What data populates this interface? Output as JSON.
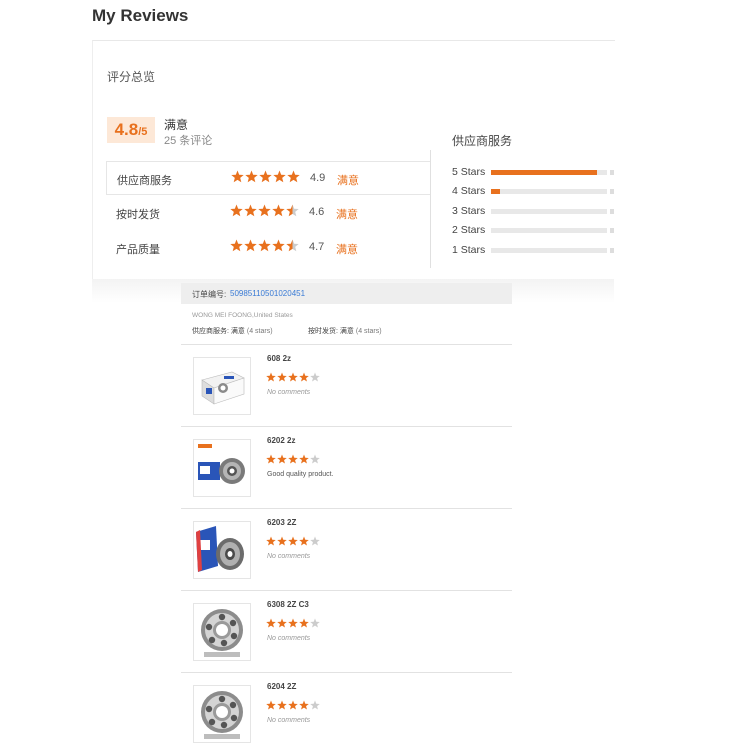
{
  "page": {
    "title": "My Reviews"
  },
  "summary": {
    "section_title": "评分总览",
    "score": "4.8",
    "score_max": "/5",
    "overall_label": "满意",
    "review_count": "25 条评论",
    "ratings": [
      {
        "label": "供应商服务",
        "stars": 5,
        "score": "4.9",
        "verdict": "满意"
      },
      {
        "label": "按时发货",
        "stars": 4.5,
        "score": "4.6",
        "verdict": "满意"
      },
      {
        "label": "产品质量",
        "stars": 4.5,
        "score": "4.7",
        "verdict": "满意"
      }
    ]
  },
  "distribution": {
    "title": "供应商服务",
    "rows": [
      {
        "label": "5 Stars",
        "fraction": 0.91
      },
      {
        "label": "4 Stars",
        "fraction": 0.08
      },
      {
        "label": "3 Stars",
        "fraction": 0
      },
      {
        "label": "2 Stars",
        "fraction": 0
      },
      {
        "label": "1 Stars",
        "fraction": 0
      }
    ]
  },
  "order": {
    "number_label": "订单编号:",
    "number": "50985110501020451",
    "buyer": "WONG MEI FOONG,United States",
    "supplier_rating": {
      "label": "供应商服务:",
      "verdict": "满意",
      "stars": "(4 stars)"
    },
    "shipping_rating": {
      "label": "按时发货:",
      "verdict": "满意",
      "stars": "(4 stars)"
    },
    "items": [
      {
        "title": "608 2z",
        "stars": 4,
        "comment": "No comments",
        "has_comment": false,
        "image": "boxed-bearing"
      },
      {
        "title": "6202 2z",
        "stars": 4,
        "comment": "Good quality product.",
        "has_comment": true,
        "image": "bearing-with-box"
      },
      {
        "title": "6203 2Z",
        "stars": 4,
        "comment": "No comments",
        "has_comment": false,
        "image": "bearing-with-box-angled"
      },
      {
        "title": "6308 2Z C3",
        "stars": 4,
        "comment": "No comments",
        "has_comment": false,
        "image": "open-ball-bearing"
      },
      {
        "title": "6204 2Z",
        "stars": 4,
        "comment": "No comments",
        "has_comment": false,
        "image": "open-ball-bearing"
      }
    ]
  },
  "colors": {
    "accent": "#e8711e",
    "link": "#3a7bd5",
    "score_bg": "#fde8d7",
    "empty_star": "#cccccc"
  }
}
